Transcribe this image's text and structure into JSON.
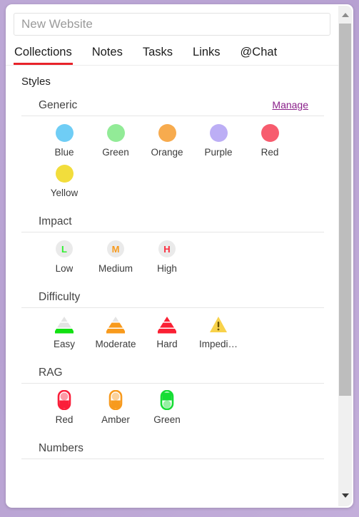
{
  "window": {
    "background_color": "#b9a3d4",
    "panel_color": "#ffffff"
  },
  "search": {
    "placeholder": "New Website",
    "value": ""
  },
  "tabs": [
    {
      "label": "Collections",
      "active": true
    },
    {
      "label": "Notes",
      "active": false
    },
    {
      "label": "Tasks",
      "active": false
    },
    {
      "label": "Links",
      "active": false
    },
    {
      "label": "@Chat",
      "active": false
    }
  ],
  "active_tab_underline_color": "#e8232a",
  "page_title": "Styles",
  "groups": [
    {
      "name": "Generic",
      "action_label": "Manage",
      "action_color": "#8a208a",
      "items": [
        {
          "label": "Blue",
          "icon": "circle-swatch-icon",
          "color": "#6fcdf5"
        },
        {
          "label": "Green",
          "icon": "circle-swatch-icon",
          "color": "#92eb97"
        },
        {
          "label": "Orange",
          "icon": "circle-swatch-icon",
          "color": "#f7ab4e"
        },
        {
          "label": "Purple",
          "icon": "circle-swatch-icon",
          "color": "#bcaef5"
        },
        {
          "label": "Red",
          "icon": "circle-swatch-icon",
          "color": "#f75c6e"
        },
        {
          "label": "Yellow",
          "icon": "circle-swatch-icon",
          "color": "#f2dd3c"
        }
      ]
    },
    {
      "name": "Impact",
      "action_label": "",
      "items": [
        {
          "label": "Low",
          "icon": "impact-low-icon",
          "letter": "L",
          "color": "#2ff02f"
        },
        {
          "label": "Medium",
          "icon": "impact-medium-icon",
          "letter": "M",
          "color": "#f79a1e"
        },
        {
          "label": "High",
          "icon": "impact-high-icon",
          "letter": "H",
          "color": "#fb2b3c"
        }
      ]
    },
    {
      "name": "Difficulty",
      "action_label": "",
      "items": [
        {
          "label": "Easy",
          "icon": "pyramid-easy-icon",
          "color": "#12e012",
          "filled": 1
        },
        {
          "label": "Moderate",
          "icon": "pyramid-moderate-icon",
          "color": "#f89a1c",
          "filled": 2
        },
        {
          "label": "Hard",
          "icon": "pyramid-hard-icon",
          "color": "#fa2033",
          "filled": 3
        },
        {
          "label": "Impedi…",
          "icon": "warning-triangle-icon",
          "color": "#f8d24a",
          "filled": 0
        }
      ]
    },
    {
      "name": "RAG",
      "action_label": "",
      "items": [
        {
          "label": "Red",
          "icon": "rag-red-icon",
          "color": "#fa1f3a",
          "lit": "bottom"
        },
        {
          "label": "Amber",
          "icon": "rag-amber-icon",
          "color": "#f79a1e",
          "lit": "bottom"
        },
        {
          "label": "Green",
          "icon": "rag-green-icon",
          "color": "#16dd34",
          "lit": "top"
        }
      ]
    },
    {
      "name": "Numbers",
      "action_label": "",
      "items": []
    }
  ],
  "scrollbar": {
    "up_arrow": "scroll-up-arrow-icon",
    "down_arrow": "scroll-down-arrow-icon"
  }
}
